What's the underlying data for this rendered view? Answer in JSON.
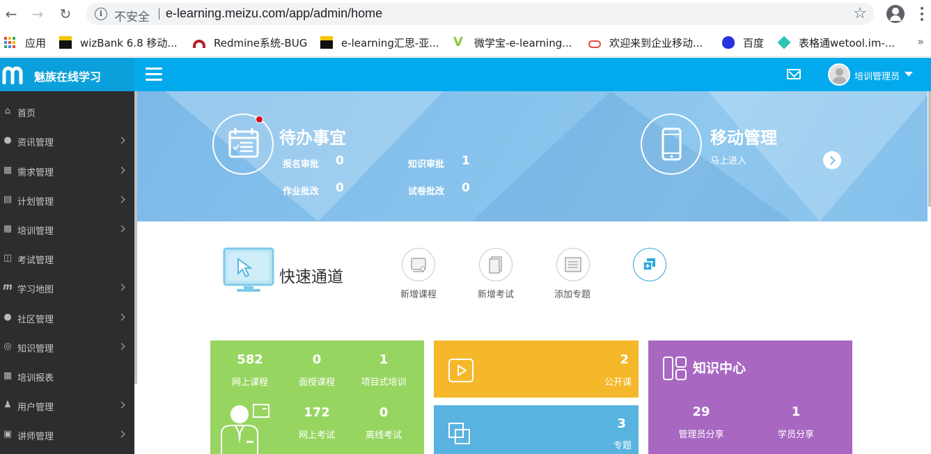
{
  "browser": {
    "insecure_label": "不安全",
    "url": "e-learning.meizu.com/app/admin/home",
    "bookmarks": [
      {
        "label": "应用",
        "icon": "apps-grid-icon"
      },
      {
        "label": "wizBank 6.8 移动...",
        "icon": "wizbank-icon"
      },
      {
        "label": "Redmine系统-BUG",
        "icon": "redmine-icon"
      },
      {
        "label": "e-learning汇思-亚...",
        "icon": "elearning-icon"
      },
      {
        "label": "微学宝-e-learning...",
        "icon": "weixuebao-icon"
      },
      {
        "label": "欢迎来到企业移动...",
        "icon": "cloud-icon"
      },
      {
        "label": "百度",
        "icon": "baidu-paw-icon"
      },
      {
        "label": "表格通wetool.im-...",
        "icon": "wetool-icon"
      }
    ],
    "overflow_label": "»"
  },
  "header": {
    "brand_name": "魅族在线学习",
    "user_name": "培训管理员"
  },
  "sidebar": {
    "items": [
      {
        "label": "首页",
        "icon": "home-icon",
        "has_arrow": false
      },
      {
        "label": "资讯管理",
        "icon": "globe-icon",
        "has_arrow": true
      },
      {
        "label": "需求管理",
        "icon": "cubes-icon",
        "has_arrow": true
      },
      {
        "label": "计划管理",
        "icon": "list-icon",
        "has_arrow": true
      },
      {
        "label": "培训管理",
        "icon": "calendar-icon",
        "has_arrow": true
      },
      {
        "label": "考试管理",
        "icon": "book-icon",
        "has_arrow": false
      },
      {
        "label": "学习地图",
        "icon": "map-m-icon",
        "has_arrow": true
      },
      {
        "label": "社区管理",
        "icon": "comments-icon",
        "has_arrow": true
      },
      {
        "label": "知识管理",
        "icon": "lifebuoy-icon",
        "has_arrow": true
      },
      {
        "label": "培训报表",
        "icon": "table-icon",
        "has_arrow": false
      },
      {
        "label": "用户管理",
        "icon": "user-icon",
        "has_arrow": true
      },
      {
        "label": "讲师管理",
        "icon": "briefcase-icon",
        "has_arrow": true
      }
    ]
  },
  "banner": {
    "todo": {
      "title": "待办事宜",
      "items": [
        {
          "label": "报名审批",
          "value": "0"
        },
        {
          "label": "知识审批",
          "value": "1"
        },
        {
          "label": "作业批改",
          "value": "0"
        },
        {
          "label": "试卷批改",
          "value": "0"
        }
      ]
    },
    "mobile": {
      "title": "移动管理",
      "subtitle": "马上进入"
    }
  },
  "quick": {
    "title": "快速通道",
    "buttons": [
      {
        "label": "新增课程",
        "icon": "new-course-icon"
      },
      {
        "label": "新增考试",
        "icon": "new-exam-icon"
      },
      {
        "label": "添加专题",
        "icon": "add-topic-icon"
      },
      {
        "label": "",
        "icon": "add-more-icon"
      }
    ]
  },
  "cards": {
    "green": {
      "color": "#97d561",
      "stats": [
        {
          "value": "582",
          "label": "网上课程"
        },
        {
          "value": "0",
          "label": "面授课程"
        },
        {
          "value": "1",
          "label": "项目式培训"
        },
        {
          "value": "172",
          "label": "网上考试"
        },
        {
          "value": "0",
          "label": "离线考试"
        }
      ]
    },
    "open_class": {
      "color": "#f5b82a",
      "value": "2",
      "label": "公开课"
    },
    "topic": {
      "color": "#59b3e0",
      "value": "3",
      "label": "专题"
    },
    "knowledge": {
      "color": "#a868c2",
      "title": "知识中心",
      "stats": [
        {
          "value": "29",
          "label": "管理员分享"
        },
        {
          "value": "1",
          "label": "学员分享"
        }
      ]
    }
  }
}
